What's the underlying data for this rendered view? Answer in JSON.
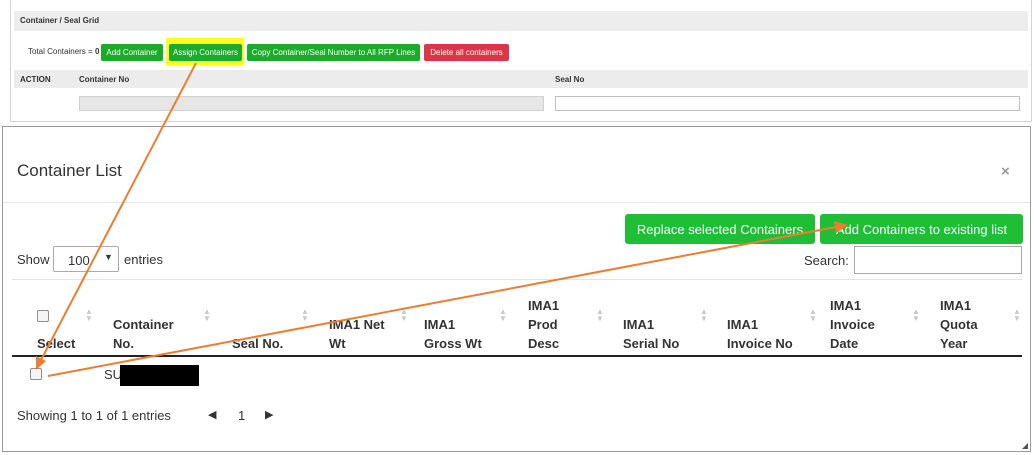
{
  "grid": {
    "title": "Container / Seal Grid",
    "total_label": "Total Containers = ",
    "total_count": "0",
    "buttons": {
      "add": "Add Container",
      "assign": "Assign Containers",
      "copy": "Copy Container/Seal Number to All RFP Lines",
      "delete": "Delete all containers"
    },
    "columns": {
      "action": "ACTION",
      "container_no": "Container No",
      "seal_no": "Seal No"
    }
  },
  "modal": {
    "title": "Container List",
    "close_glyph": "×",
    "buttons": {
      "replace": "Replace selected Containers",
      "add_existing": "Add Containers to existing list"
    },
    "length": {
      "show": "Show",
      "value": "100",
      "entries": "entries"
    },
    "search_label": "Search:",
    "columns": [
      [
        "Select"
      ],
      [
        "Container",
        "No."
      ],
      [
        "Seal No."
      ],
      [
        "IMA1 Net",
        "Wt"
      ],
      [
        "IMA1",
        "Gross Wt"
      ],
      [
        "IMA1",
        "Prod",
        "Desc"
      ],
      [
        "IMA1",
        "Serial No"
      ],
      [
        "IMA1",
        "Invoice No"
      ],
      [
        "IMA1",
        "Invoice",
        "Date"
      ],
      [
        "IMA1",
        "Quota",
        "Year"
      ]
    ],
    "rows": [
      {
        "container_no": "SU"
      }
    ],
    "info": "Showing 1 to 1 of 1 entries",
    "pager": {
      "prev": "◀",
      "page": "1",
      "next": "▶"
    }
  },
  "colors": {
    "green_button": "#1aab2b",
    "modal_button": "#1ebf35",
    "delete_button": "#dc3545",
    "highlight": "#ffff1a",
    "annotation_arrow": "#ed7d31"
  }
}
